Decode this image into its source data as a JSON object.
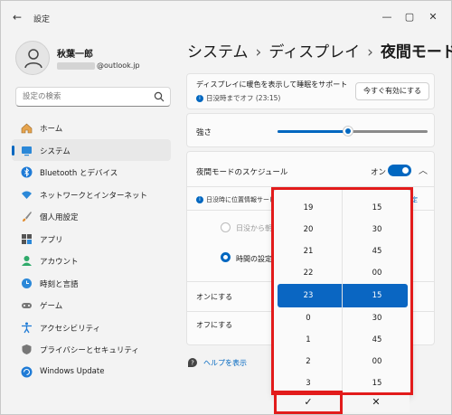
{
  "app": {
    "title": "設定"
  },
  "user": {
    "name": "秋葉一郎",
    "email_suffix": "@outlook.jp"
  },
  "search": {
    "placeholder": "設定の検索"
  },
  "nav": {
    "items": [
      {
        "label": "ホーム",
        "icon": "home-icon"
      },
      {
        "label": "システム",
        "icon": "system-icon",
        "active": true
      },
      {
        "label": "Bluetooth とデバイス",
        "icon": "bluetooth-icon"
      },
      {
        "label": "ネットワークとインターネット",
        "icon": "wifi-icon"
      },
      {
        "label": "個人用設定",
        "icon": "brush-icon"
      },
      {
        "label": "アプリ",
        "icon": "apps-icon"
      },
      {
        "label": "アカウント",
        "icon": "account-icon"
      },
      {
        "label": "時刻と言語",
        "icon": "clock-globe-icon"
      },
      {
        "label": "ゲーム",
        "icon": "gamepad-icon"
      },
      {
        "label": "アクセシビリティ",
        "icon": "accessibility-icon"
      },
      {
        "label": "プライバシーとセキュリティ",
        "icon": "shield-icon"
      },
      {
        "label": "Windows Update",
        "icon": "update-icon"
      }
    ]
  },
  "breadcrumb": {
    "part1": "システム",
    "part2": "ディスプレイ",
    "current": "夜間モード",
    "sep": "›"
  },
  "night_light": {
    "description": "ディスプレイに暖色を表示して睡眠をサポート",
    "status": "日没時までオフ (23:15)",
    "turn_on_now": "今すぐ有効にする",
    "strength_label": "強さ",
    "strength": 0.47,
    "schedule_label": "夜間モードのスケジュール",
    "schedule_state": "オン",
    "location_note": "日没時に位置情報サービ",
    "location_link": "定",
    "option_sunset": "日没から朝",
    "option_hours": "時間の設定",
    "turn_on_label": "オンにする",
    "turn_off_label": "オフにする"
  },
  "time_picker": {
    "hours": [
      "19",
      "20",
      "21",
      "22",
      "23",
      "0",
      "1",
      "2",
      "3"
    ],
    "minutes": [
      "15",
      "30",
      "45",
      "00",
      "15",
      "30",
      "45",
      "00",
      "15"
    ],
    "selected_hour": "23",
    "selected_minute": "15",
    "confirm_glyph": "✓",
    "dismiss_glyph": "✕"
  },
  "help": {
    "label": "ヘルプを表示"
  },
  "colors": {
    "accent": "#0067c0",
    "highlight": "#e21b1b"
  }
}
